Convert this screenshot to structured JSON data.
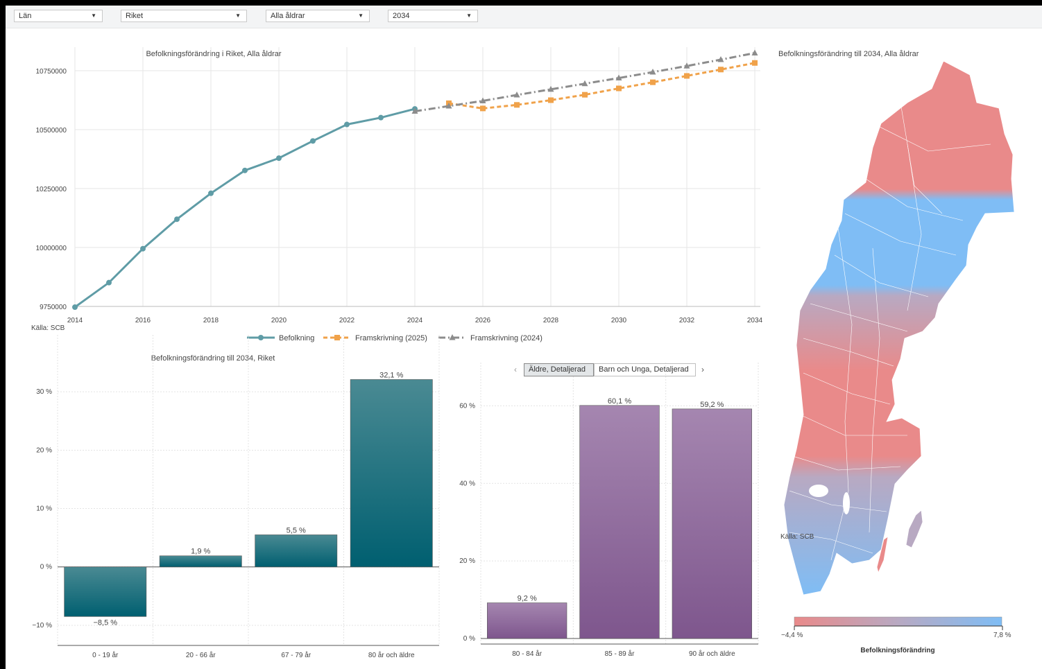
{
  "toolbar": {
    "dropdowns": [
      {
        "value": "Län"
      },
      {
        "value": "Riket"
      },
      {
        "value": "Alla åldrar"
      },
      {
        "value": "2034"
      }
    ]
  },
  "line_chart": {
    "title": "Befolkningsförändring i  Riket, Alla åldrar",
    "source": "Källa: SCB"
  },
  "bar_chart_left": {
    "title": "Befolkningsförändring till 2034, Riket"
  },
  "bar_chart_right": {
    "tabs": [
      {
        "label": "Äldre, Detaljerad",
        "active": true
      },
      {
        "label": "Barn och Unga, Detaljerad",
        "active": false
      }
    ]
  },
  "map": {
    "title": "Befolkningsförändring  till 2034, Alla åldrar",
    "source": "Källa: SCB",
    "legend_title": "Befolkningsförändring",
    "legend_min": "−4,4 %",
    "legend_max": "7,8 %",
    "colors": {
      "low": "#e98a8a",
      "mid": "#b8a9c2",
      "high": "#7fbdf5"
    }
  },
  "chart_data": [
    {
      "type": "line",
      "title": "Befolkningsförändring i  Riket, Alla åldrar",
      "x_ticks": [
        "2014",
        "2016",
        "2018",
        "2020",
        "2022",
        "2024",
        "2026",
        "2028",
        "2030",
        "2032",
        "2034"
      ],
      "y_ticks": [
        "9750000",
        "10000000",
        "10250000",
        "10500000",
        "10750000"
      ],
      "xlim": [
        2014,
        2034
      ],
      "ylim": [
        9750000,
        10750000
      ],
      "grid": true,
      "legend_position": "bottom",
      "series": [
        {
          "name": "Befolkning",
          "color": "#5f9ca6",
          "style": "solid",
          "marker": "circle",
          "x": [
            2014,
            2015,
            2016,
            2017,
            2018,
            2019,
            2020,
            2021,
            2022,
            2023,
            2024
          ],
          "y": [
            9747000,
            9851000,
            9995000,
            10120000,
            10230000,
            10327000,
            10379000,
            10452000,
            10522000,
            10551000,
            10588000
          ]
        },
        {
          "name": "Framskrivning (2025)",
          "color": "#f0a24a",
          "style": "dashed",
          "marker": "square",
          "x": [
            2025,
            2026,
            2027,
            2028,
            2029,
            2030,
            2031,
            2032,
            2033,
            2034
          ],
          "y": [
            10612000,
            10590000,
            10605000,
            10625000,
            10648000,
            10675000,
            10701000,
            10728000,
            10755000,
            10783000
          ]
        },
        {
          "name": "Framskrivning (2024)",
          "color": "#8c8c8c",
          "style": "dashdot",
          "marker": "triangle",
          "x": [
            2024,
            2025,
            2026,
            2027,
            2028,
            2029,
            2030,
            2031,
            2032,
            2033,
            2034
          ],
          "y": [
            10578000,
            10600000,
            10622000,
            10647000,
            10671000,
            10695000,
            10719000,
            10744000,
            10770000,
            10797000,
            10825000
          ]
        }
      ]
    },
    {
      "type": "bar",
      "title": "Befolkningsförändring till 2034, Riket",
      "categories": [
        "0 - 19 år",
        "20 - 66 år",
        "67 - 79 år",
        "80 år och äldre"
      ],
      "values": [
        -8.5,
        1.9,
        5.5,
        32.1
      ],
      "value_labels": [
        "−8,5 %",
        "1,9 %",
        "5,5 %",
        "32,1 %"
      ],
      "y_ticks": [
        "−10 %",
        "0 %",
        "10 %",
        "20 %",
        "30 %"
      ],
      "ylim": [
        -12.5,
        35
      ],
      "color": "#005f70"
    },
    {
      "type": "bar",
      "title": "",
      "categories": [
        "80 - 84 år",
        "85 - 89 år",
        "90 år och äldre"
      ],
      "values": [
        9.2,
        60.1,
        59.2
      ],
      "value_labels": [
        "9,2 %",
        "60,1 %",
        "59,2 %"
      ],
      "y_ticks": [
        "0 %",
        "20 %",
        "40 %",
        "60 %"
      ],
      "ylim": [
        0,
        64
      ],
      "color": "#7e568d"
    }
  ]
}
